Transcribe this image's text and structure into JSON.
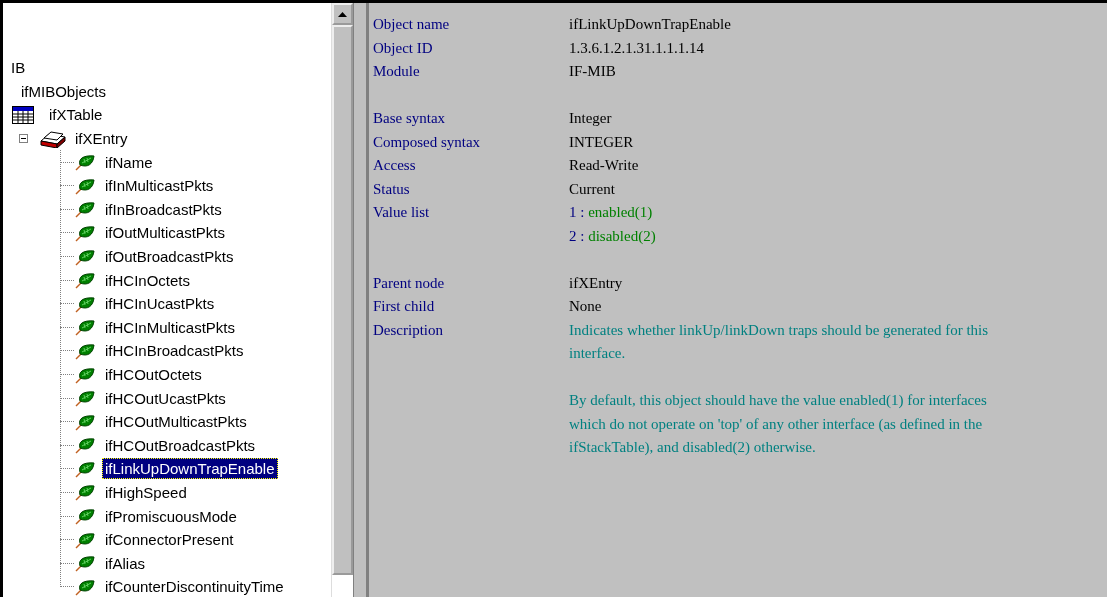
{
  "tree": {
    "nodes": [
      {
        "label": "IB",
        "selected": false,
        "children": [
          {
            "label": "ifMIBObjects",
            "selected": false,
            "children": [
              {
                "label": "ifXTable",
                "kind": "table",
                "selected": false,
                "children": [
                  {
                    "label": "ifXEntry",
                    "kind": "entry",
                    "selected": false,
                    "expanded": true,
                    "children": [
                      {
                        "label": "ifName",
                        "kind": "leaf",
                        "selected": false
                      },
                      {
                        "label": "ifInMulticastPkts",
                        "kind": "leaf",
                        "selected": false
                      },
                      {
                        "label": "ifInBroadcastPkts",
                        "kind": "leaf",
                        "selected": false
                      },
                      {
                        "label": "ifOutMulticastPkts",
                        "kind": "leaf",
                        "selected": false
                      },
                      {
                        "label": "ifOutBroadcastPkts",
                        "kind": "leaf",
                        "selected": false
                      },
                      {
                        "label": "ifHCInOctets",
                        "kind": "leaf",
                        "selected": false
                      },
                      {
                        "label": "ifHCInUcastPkts",
                        "kind": "leaf",
                        "selected": false
                      },
                      {
                        "label": "ifHCInMulticastPkts",
                        "kind": "leaf",
                        "selected": false
                      },
                      {
                        "label": "ifHCInBroadcastPkts",
                        "kind": "leaf",
                        "selected": false
                      },
                      {
                        "label": "ifHCOutOctets",
                        "kind": "leaf",
                        "selected": false
                      },
                      {
                        "label": "ifHCOutUcastPkts",
                        "kind": "leaf",
                        "selected": false
                      },
                      {
                        "label": "ifHCOutMulticastPkts",
                        "kind": "leaf",
                        "selected": false
                      },
                      {
                        "label": "ifHCOutBroadcastPkts",
                        "kind": "leaf",
                        "selected": false
                      },
                      {
                        "label": "ifLinkUpDownTrapEnable",
                        "kind": "leaf",
                        "selected": true
                      },
                      {
                        "label": "ifHighSpeed",
                        "kind": "leaf",
                        "selected": false
                      },
                      {
                        "label": "ifPromiscuousMode",
                        "kind": "leaf",
                        "selected": false
                      },
                      {
                        "label": "ifConnectorPresent",
                        "kind": "leaf",
                        "selected": false
                      },
                      {
                        "label": "ifAlias",
                        "kind": "leaf",
                        "selected": false
                      },
                      {
                        "label": "ifCounterDiscontinuityTime",
                        "kind": "leaf",
                        "selected": false
                      }
                    ]
                  }
                ]
              }
            ]
          }
        ]
      }
    ]
  },
  "details": {
    "groups": [
      [
        {
          "label": "Object name",
          "kind": "text",
          "value": "ifLinkUpDownTrapEnable"
        },
        {
          "label": "Object ID",
          "kind": "text",
          "value": "1.3.6.1.2.1.31.1.1.1.14"
        },
        {
          "label": "Module",
          "kind": "text",
          "value": "IF-MIB"
        }
      ],
      [
        {
          "label": "Base syntax",
          "kind": "text",
          "value": "Integer"
        },
        {
          "label": "Composed syntax",
          "kind": "text",
          "value": "INTEGER"
        },
        {
          "label": "Access",
          "kind": "text",
          "value": "Read-Write"
        },
        {
          "label": "Status",
          "kind": "text",
          "value": "Current"
        },
        {
          "label": "Value list",
          "kind": "enum",
          "values": [
            {
              "number": "1",
              "separator": ":",
              "text": "enabled(1)"
            },
            {
              "number": "2",
              "separator": ":",
              "text": "disabled(2)"
            }
          ]
        }
      ],
      [
        {
          "label": "Parent node",
          "kind": "text",
          "value": "ifXEntry"
        },
        {
          "label": "First child",
          "kind": "text",
          "value": "None"
        },
        {
          "label": "Description",
          "kind": "description",
          "paragraphs": [
            "Indicates whether linkUp/linkDown traps should be generated for this interface.",
            "By default, this object should have the value enabled(1) for interfaces which do not operate on 'top' of any other interface (as defined in the ifStackTable), and disabled(2) otherwise."
          ]
        }
      ]
    ]
  }
}
